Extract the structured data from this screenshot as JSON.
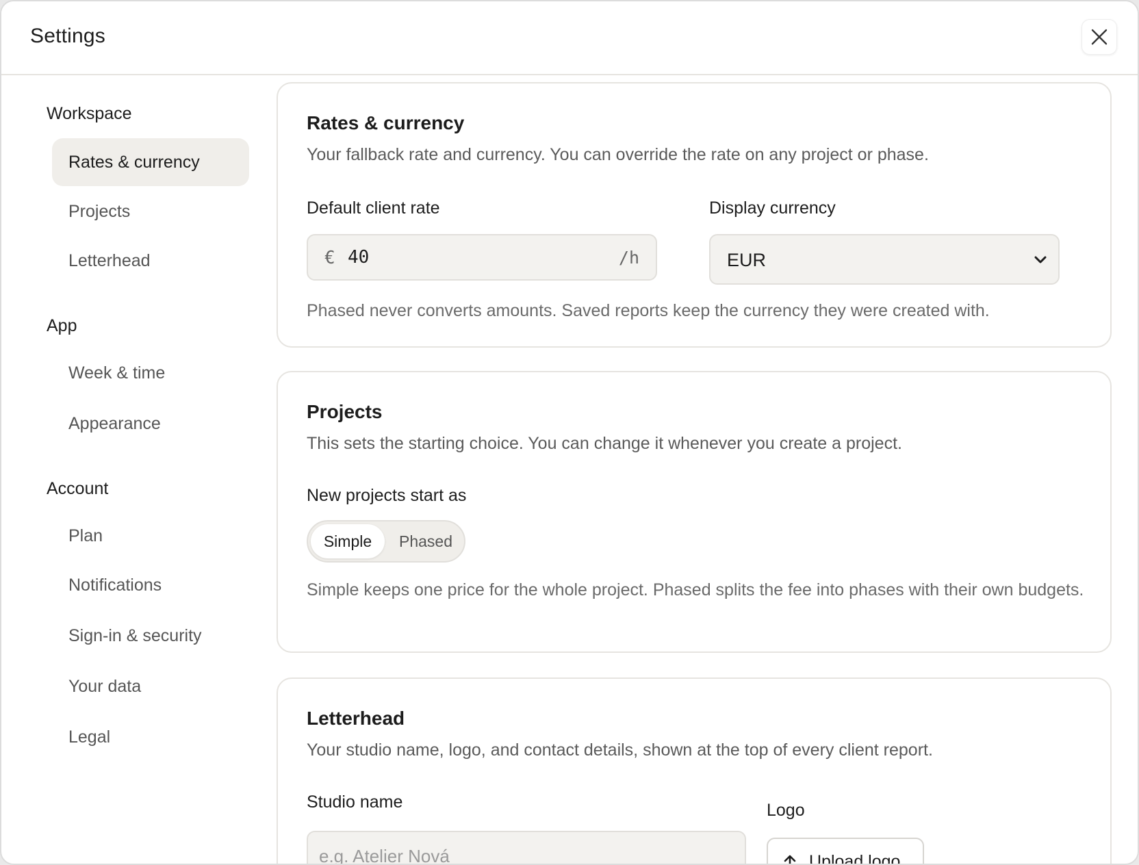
{
  "header": {
    "title": "Settings"
  },
  "sidebar": {
    "groups": [
      {
        "title": "Workspace",
        "items": [
          "Rates & currency",
          "Projects",
          "Letterhead"
        ]
      },
      {
        "title": "App",
        "items": [
          "Week & time",
          "Appearance"
        ]
      },
      {
        "title": "Account",
        "items": [
          "Plan",
          "Notifications",
          "Sign-in & security",
          "Your data",
          "Legal"
        ]
      }
    ],
    "active_item": "Rates & currency"
  },
  "rates": {
    "title": "Rates & currency",
    "description": "Your fallback rate and currency. You can override the rate on any project or phase.",
    "rate_label": "Default client rate",
    "currency_symbol": "€",
    "rate_value": "40",
    "rate_unit": "/h",
    "currency_label": "Display currency",
    "currency_value": "EUR",
    "note": "Phased never converts amounts. Saved reports keep the currency they were created with."
  },
  "projects": {
    "title": "Projects",
    "description": "This sets the starting choice. You can change it whenever you create a project.",
    "start_label": "New projects start as",
    "options": [
      "Simple",
      "Phased"
    ],
    "selected": "Simple",
    "note": "Simple keeps one price for the whole project. Phased splits the fee into phases with their own budgets."
  },
  "letterhead": {
    "title": "Letterhead",
    "description": "Your studio name, logo, and contact details, shown at the top of every client report.",
    "studio_label": "Studio name",
    "studio_placeholder": "e.g. Atelier Nová",
    "logo_label": "Logo",
    "upload_label": "Upload logo"
  }
}
